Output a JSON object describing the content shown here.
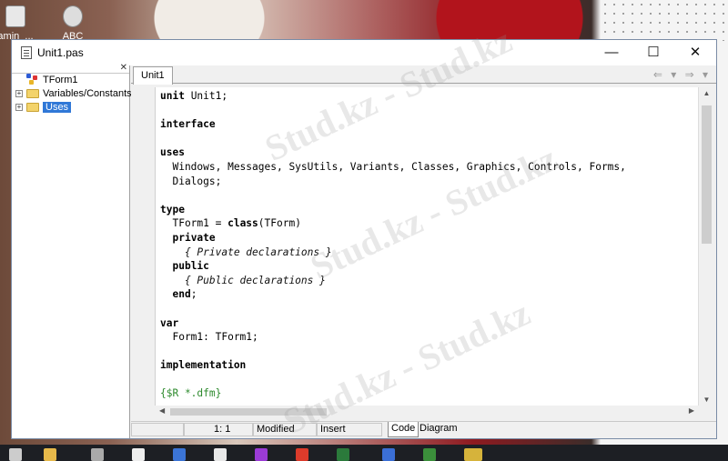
{
  "desktop": {
    "icons": [
      {
        "label": "amin_...",
        "icon": "file-icon"
      },
      {
        "label": "ABC",
        "icon": "gear-app-icon"
      }
    ]
  },
  "window": {
    "title": "Unit1.pas",
    "controls": {
      "minimize": "—",
      "maximize": "☐",
      "close": "✕"
    }
  },
  "tree": {
    "close_glyph": "✕",
    "items": [
      {
        "label": "TForm1",
        "icon": "class-icon",
        "expander": ""
      },
      {
        "label": "Variables/Constants",
        "icon": "folder-icon",
        "expander": "+"
      },
      {
        "label": "Uses",
        "icon": "folder-icon",
        "expander": "+",
        "selected": true
      }
    ]
  },
  "editor": {
    "tab": "Unit1",
    "nav": "⇐ ▾ ⇒ ▾",
    "code_lines": [
      "unit Unit1;",
      "",
      "interface",
      "",
      "uses",
      "  Windows, Messages, SysUtils, Variants, Classes, Graphics, Controls, Forms,",
      "  Dialogs;",
      "",
      "type",
      "  TForm1 = class(TForm)",
      "  private",
      "    { Private declarations }",
      "  public",
      "    { Public declarations }",
      "  end;",
      "",
      "var",
      "  Form1: TForm1;",
      "",
      "implementation",
      "",
      "{$R *.dfm}"
    ]
  },
  "statusbar": {
    "position": "1:   1",
    "state": "Modified",
    "mode": "Insert",
    "tabs": [
      "Code",
      "Diagram"
    ]
  },
  "watermark": "Stud.kz - Stud.kz"
}
